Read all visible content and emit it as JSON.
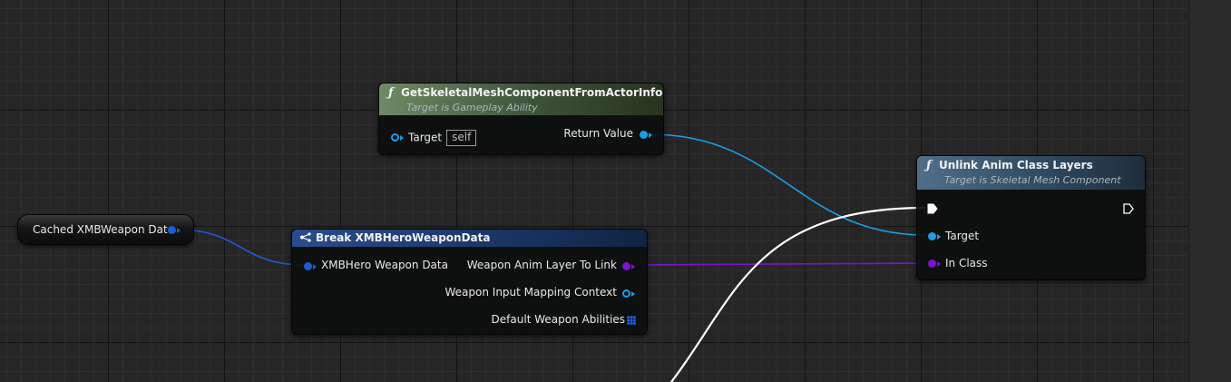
{
  "nodes": {
    "get_mesh": {
      "title": "GetSkeletalMeshComponentFromActorInfo",
      "subtitle": "Target is Gameplay Ability",
      "target_label": "Target",
      "target_default": "self",
      "return_label": "Return Value"
    },
    "unlink": {
      "title": "Unlink Anim Class Layers",
      "subtitle": "Target is Skeletal Mesh Component",
      "target_label": "Target",
      "in_class_label": "In Class"
    },
    "cached_var": {
      "label": "Cached XMBWeapon Data"
    },
    "break": {
      "title": "Break XMBHeroWeaponData",
      "input_label": "XMBHero Weapon Data",
      "outputs": [
        "Weapon Anim Layer To Link",
        "Weapon Input Mapping Context",
        "Default Weapon Abilities"
      ]
    }
  },
  "icons": [
    "function-icon",
    "break-struct-icon",
    "exec-pin-icon",
    "array-pin-icon"
  ],
  "colors": {
    "object_pin": "#1a9ee6",
    "class_pin": "#7a14d0",
    "struct_pin": "#1e5bd8",
    "exec_wire": "#ffffff"
  }
}
